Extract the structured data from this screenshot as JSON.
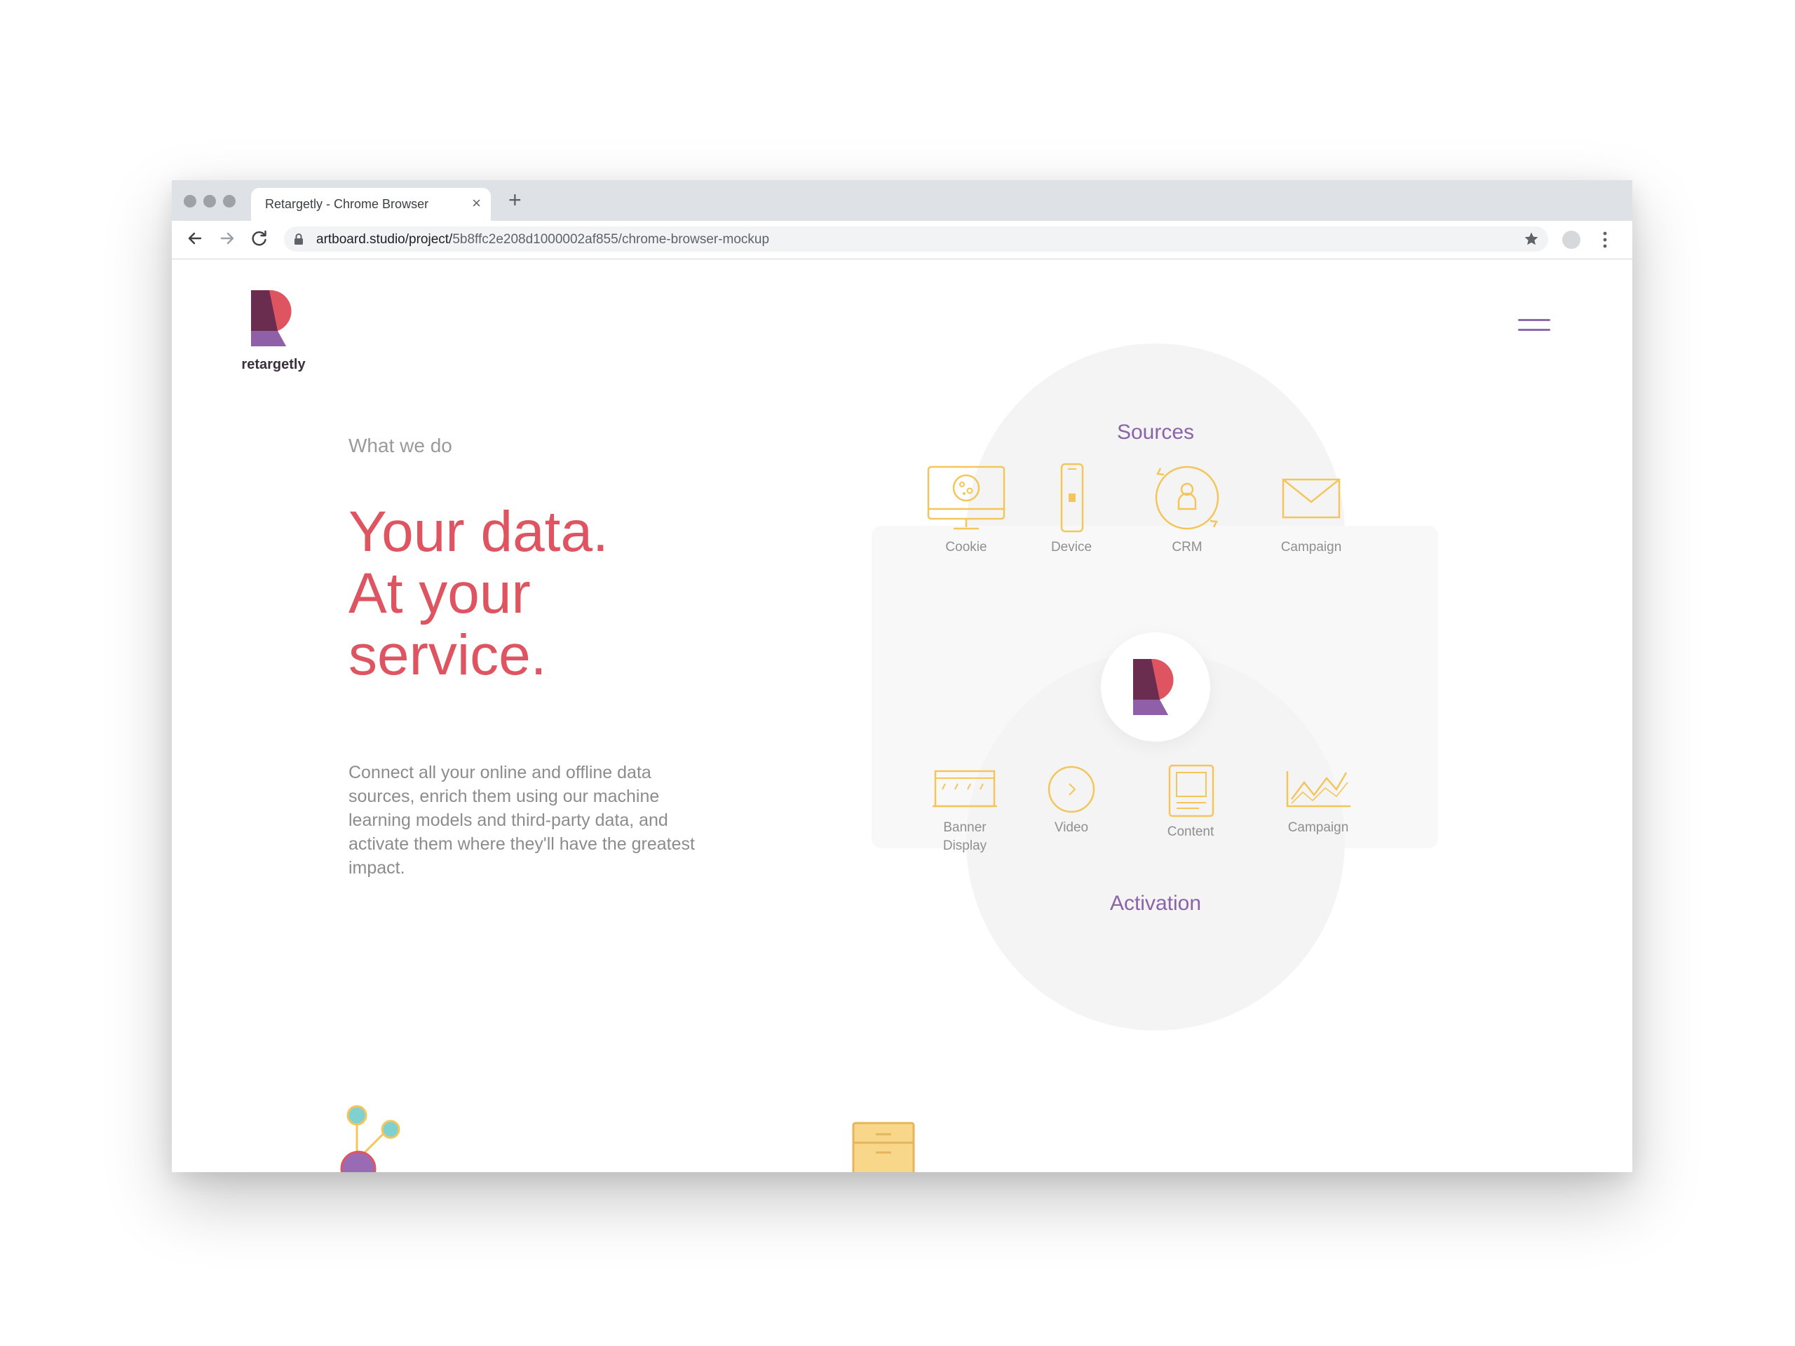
{
  "browser": {
    "tab_title": "Retargetly - Chrome Browser",
    "tab_close": "×",
    "new_tab": "+",
    "url_host": "artboard.studio/project/",
    "url_path": "5b8ffc2e208d1000002af855/chrome-browser-mockup"
  },
  "site": {
    "logo_text": "retargetly",
    "brand_colors": {
      "red": "#de5460",
      "purple": "#8a63a8",
      "dark": "#6b2d4f",
      "icon_yellow": "#f3c65c"
    }
  },
  "hero": {
    "eyebrow": "What we do",
    "headline": [
      "Your data.",
      "At your",
      "service."
    ],
    "body": "Connect all your online and offline data sources, enrich them using our machine learning models and third-party data, and activate them where they'll have the greatest impact."
  },
  "diagram": {
    "sources_title": "Sources",
    "activation_title": "Activation",
    "sources": [
      {
        "label": "Cookie",
        "icon": "monitor-cookie-icon"
      },
      {
        "label": "Device",
        "icon": "smartphone-icon"
      },
      {
        "label": "CRM",
        "icon": "crm-user-cycle-icon"
      },
      {
        "label": "Campaign",
        "icon": "envelope-icon"
      }
    ],
    "activation": [
      {
        "label": "Banner\nDisplay",
        "label_line1": "Banner",
        "label_line2": "Display",
        "icon": "banner-display-icon"
      },
      {
        "label": "Video",
        "icon": "play-circle-icon"
      },
      {
        "label": "Content",
        "icon": "content-tablet-icon"
      },
      {
        "label": "Campaign",
        "icon": "chart-line-icon"
      }
    ]
  }
}
